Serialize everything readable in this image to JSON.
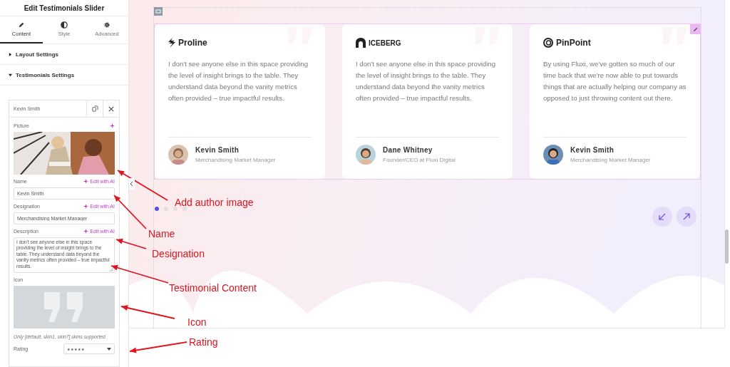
{
  "panel": {
    "title": "Edit Testimonials Slider",
    "tabs": [
      {
        "label": "Content",
        "selected": true
      },
      {
        "label": "Style",
        "selected": false
      },
      {
        "label": "Advanced",
        "selected": false
      }
    ],
    "sections": [
      {
        "label": "Layout Settings",
        "expanded": false
      },
      {
        "label": "Testimonials Settings",
        "expanded": true
      }
    ],
    "item": {
      "title": "Kevin Smith",
      "picture_label": "Picture",
      "fields": [
        {
          "kind": "input",
          "label": "Name",
          "ai": "Edit with AI",
          "value": "Kevin Smith"
        },
        {
          "kind": "input",
          "label": "Designation",
          "ai": "Edit with AI",
          "value": "Merchandising Market Manager"
        },
        {
          "kind": "textarea",
          "label": "Description",
          "ai": "Edit with AI",
          "value": "I don't see anyone else in this space providing the level of insight brings to the table. They understand data beyond the vanity metrics often provided – true impactful results."
        }
      ],
      "icon_label": "Icon",
      "note": "Only [default, skin1, skin7] skins supported",
      "rating": {
        "label": "Rating",
        "value": "★★★★★"
      }
    }
  },
  "testimonials": [
    {
      "brand": "Proline",
      "quote": "I don't see anyone else in this space providing the level of insight brings to the table. They understand data beyond the vanity metrics often provided – true impactful results.",
      "name": "Kevin Smith",
      "role": "Merchandising Market Manager"
    },
    {
      "brand": "ICEBERG",
      "quote": "I don't see anyone else in this space providing the level of insight brings to the table. They understand data beyond the vanity metrics often provided – true impactful results.",
      "name": "Dane Whitney",
      "role": "Founder/CEO at Fluxi Digital"
    },
    {
      "brand": "PinPoint",
      "quote": "By using Fluxi, we've gotten so much of our time back that we're now able to put towards things that are actually helping our company as opposed to just throwing content out there.",
      "name": "Kevin Smith",
      "role": "Merchandising Market Manager"
    }
  ],
  "pagination": [
    {
      "selected": true
    },
    {
      "selected": false
    },
    {
      "selected": false
    },
    {
      "selected": false
    }
  ],
  "annotations": [
    "Add author image",
    "Name",
    "Designation",
    "Testimonial Content",
    "Icon",
    "Rating"
  ]
}
